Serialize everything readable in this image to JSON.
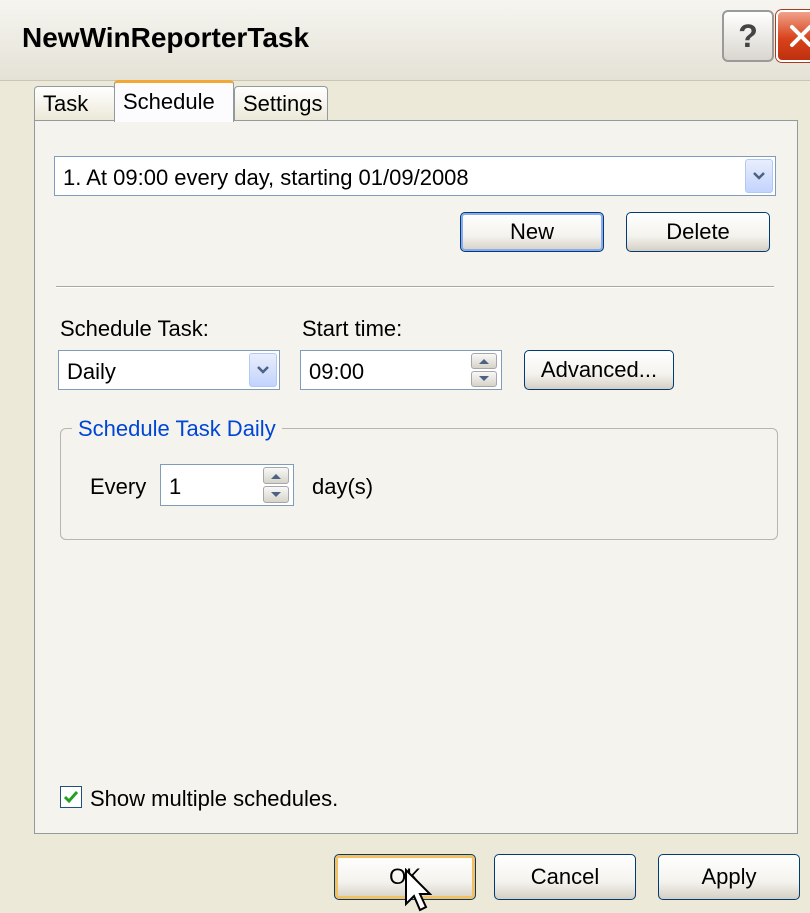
{
  "window": {
    "title": "NewWinReporterTask",
    "help_label": "?"
  },
  "tabs": [
    {
      "label": "Task",
      "active": false
    },
    {
      "label": "Schedule",
      "active": true
    },
    {
      "label": "Settings",
      "active": false
    }
  ],
  "schedule_list": {
    "selected": "1. At 09:00 every day, starting 01/09/2008",
    "new_label": "New",
    "delete_label": "Delete"
  },
  "schedule_task": {
    "label": "Schedule Task:",
    "value": "Daily"
  },
  "start_time": {
    "label": "Start time:",
    "value": "09:00",
    "advanced_label": "Advanced..."
  },
  "daily_group": {
    "title": "Schedule Task Daily",
    "every_label": "Every",
    "every_value": "1",
    "unit_label": "day(s)"
  },
  "show_multiple": {
    "label": "Show multiple schedules.",
    "checked": true
  },
  "footer": {
    "ok_label": "OK",
    "cancel_label": "Cancel",
    "apply_label": "Apply"
  },
  "colors": {
    "window_bg": "#ece9d8",
    "group_title": "#0046d5",
    "close_button": "#d8431b",
    "active_tab_accent": "#f3a834"
  }
}
